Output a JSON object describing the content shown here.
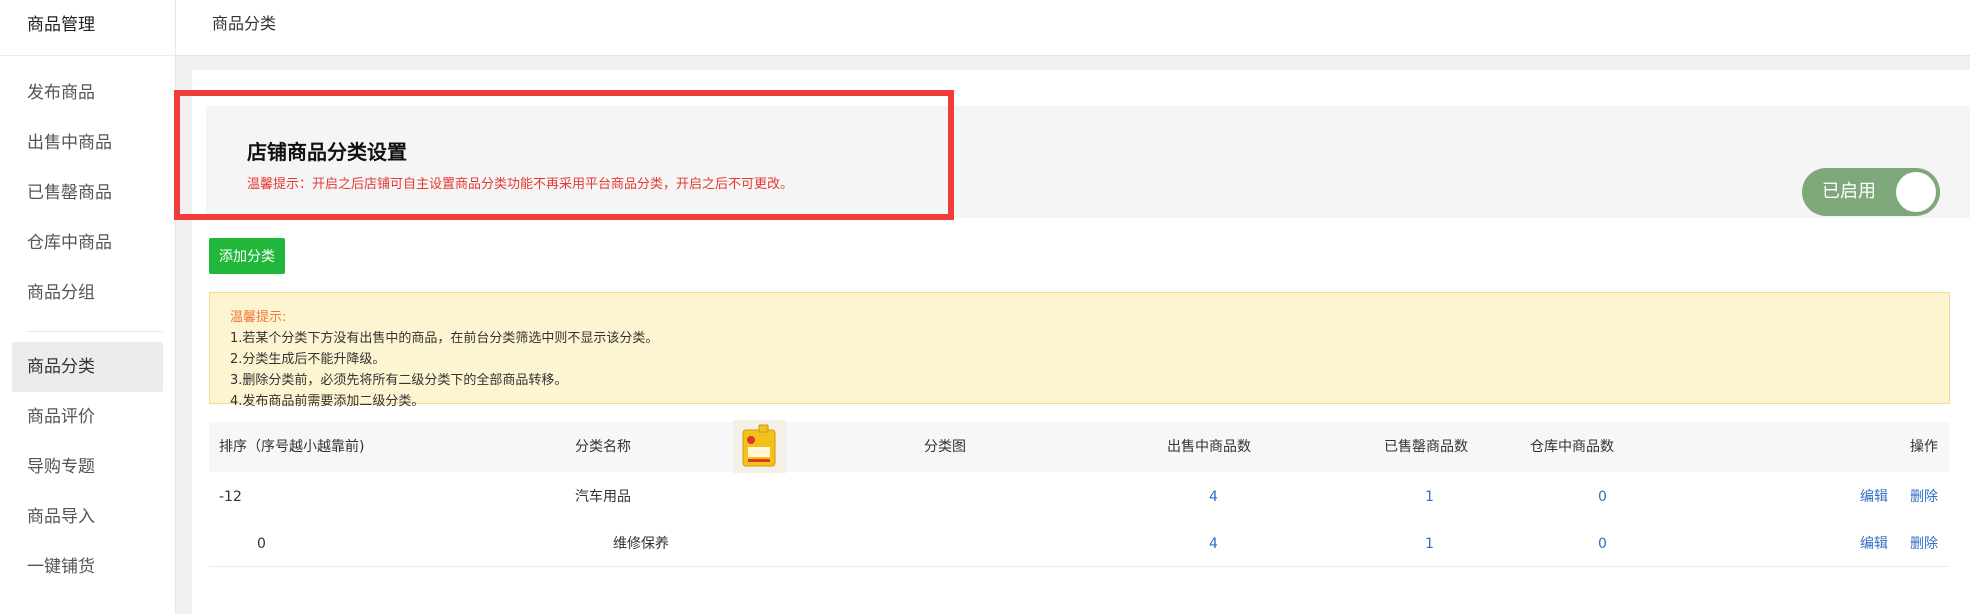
{
  "sidebar": {
    "title": "商品管理",
    "group1": [
      "发布商品",
      "出售中商品",
      "已售罄商品",
      "仓库中商品",
      "商品分组"
    ],
    "group2": [
      "商品分类",
      "商品评价",
      "导购专题",
      "商品导入",
      "一键铺货"
    ]
  },
  "header": {
    "breadcrumb": "商品分类"
  },
  "settings": {
    "title": "店铺商品分类设置",
    "tip": "温馨提示：开启之后店铺可自主设置商品分类功能不再采用平台商品分类，开启之后不可更改。",
    "toggle_label": "已启用",
    "toggle_on": true
  },
  "add_button": "添加分类",
  "notice": {
    "title": "温馨提示:",
    "lines": [
      "1.若某个分类下方没有出售中的商品，在前台分类筛选中则不显示该分类。",
      "2.分类生成后不能升降级。",
      "3.删除分类前，必须先将所有二级分类下的全部商品转移。",
      "4.发布商品前需要添加二级分类。"
    ]
  },
  "table": {
    "headers": [
      "排序（序号越小越靠前)",
      "分类名称",
      "分类图",
      "出售中商品数",
      "已售罄商品数",
      "仓库中商品数",
      "操作"
    ],
    "rows": [
      {
        "sort": "-12",
        "name": "汽车用品",
        "on_sale": "4",
        "sold_out": "1",
        "in_stock": "0",
        "edit": "编辑",
        "delete": "删除"
      },
      {
        "sort": "0",
        "name": "维修保养",
        "on_sale": "4",
        "sold_out": "1",
        "in_stock": "0",
        "edit": "编辑",
        "delete": "删除"
      }
    ]
  },
  "colors": {
    "accent_green": "#20b73a",
    "toggle_bg": "#7fa87a",
    "warning_red": "#e53935",
    "link_blue": "#2f6fc6",
    "highlight_border": "#f23b3b"
  }
}
